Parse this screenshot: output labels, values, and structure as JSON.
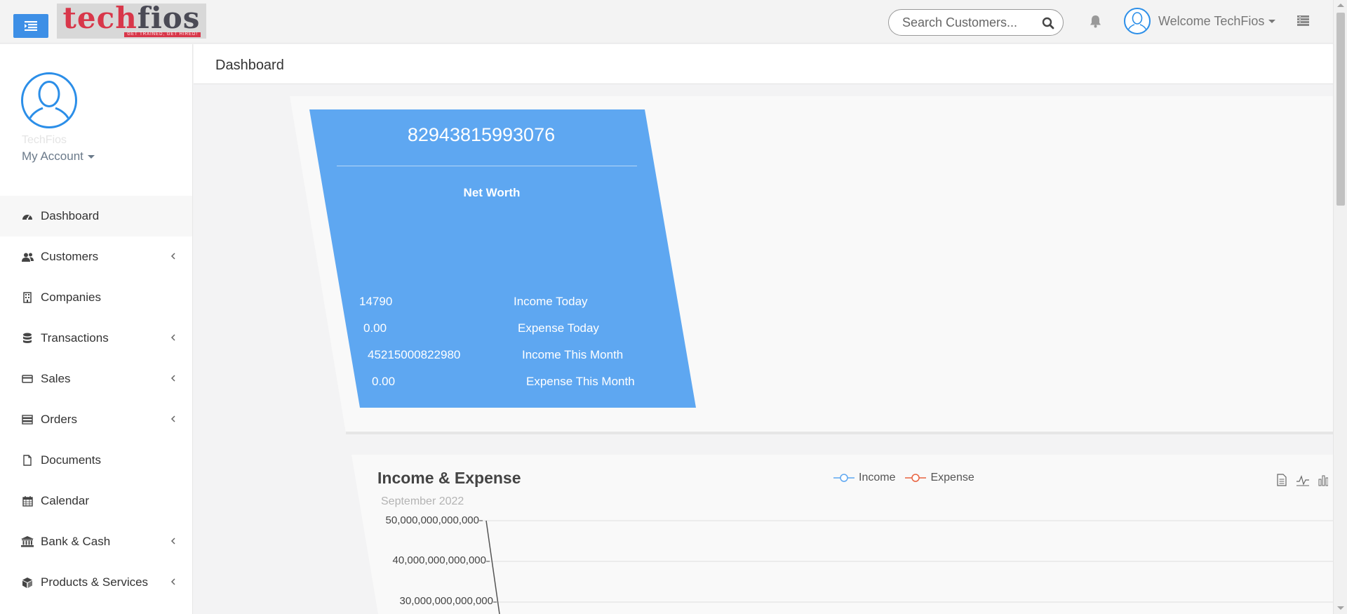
{
  "header": {
    "logo_text_main": "tech",
    "logo_text_accent": "fios",
    "logo_tagline": "GET TRAINED, GET HIRED!",
    "search_placeholder": "Search Customers...",
    "welcome": "Welcome TechFios"
  },
  "sidebar": {
    "profile_name": "TechFios",
    "my_account": "My Account",
    "items": [
      {
        "label": "Dashboard",
        "icon": "dashboard-icon",
        "has_submenu": false
      },
      {
        "label": "Customers",
        "icon": "users-icon",
        "has_submenu": true
      },
      {
        "label": "Companies",
        "icon": "building-icon",
        "has_submenu": false
      },
      {
        "label": "Transactions",
        "icon": "database-icon",
        "has_submenu": true
      },
      {
        "label": "Sales",
        "icon": "credit-card-icon",
        "has_submenu": true
      },
      {
        "label": "Orders",
        "icon": "server-icon",
        "has_submenu": true
      },
      {
        "label": "Documents",
        "icon": "file-icon",
        "has_submenu": false
      },
      {
        "label": "Calendar",
        "icon": "calendar-icon",
        "has_submenu": false
      },
      {
        "label": "Bank & Cash",
        "icon": "bank-icon",
        "has_submenu": true
      },
      {
        "label": "Products & Services",
        "icon": "cube-icon",
        "has_submenu": true
      }
    ]
  },
  "main": {
    "page_title": "Dashboard",
    "networth": {
      "value": "82943815993076",
      "label": "Net Worth",
      "rows": [
        {
          "value": "14790",
          "label": "Income Today"
        },
        {
          "value": "0.00",
          "label": "Expense Today"
        },
        {
          "value": "45215000822980",
          "label": "Income This Month"
        },
        {
          "value": "0.00",
          "label": "Expense This Month"
        }
      ]
    },
    "chart": {
      "title": "Income & Expense",
      "subtitle": "September 2022",
      "legend": [
        {
          "name": "Income",
          "color": "#5ea7f1"
        },
        {
          "name": "Expense",
          "color": "#e8623f"
        }
      ],
      "y_ticks": [
        "50,000,000,000,000",
        "40,000,000,000,000",
        "30,000,000,000,000"
      ]
    }
  },
  "colors": {
    "accent": "#3d8fe6",
    "networth_bg": "#5ea7f1",
    "brand_red": "#d8374a"
  }
}
